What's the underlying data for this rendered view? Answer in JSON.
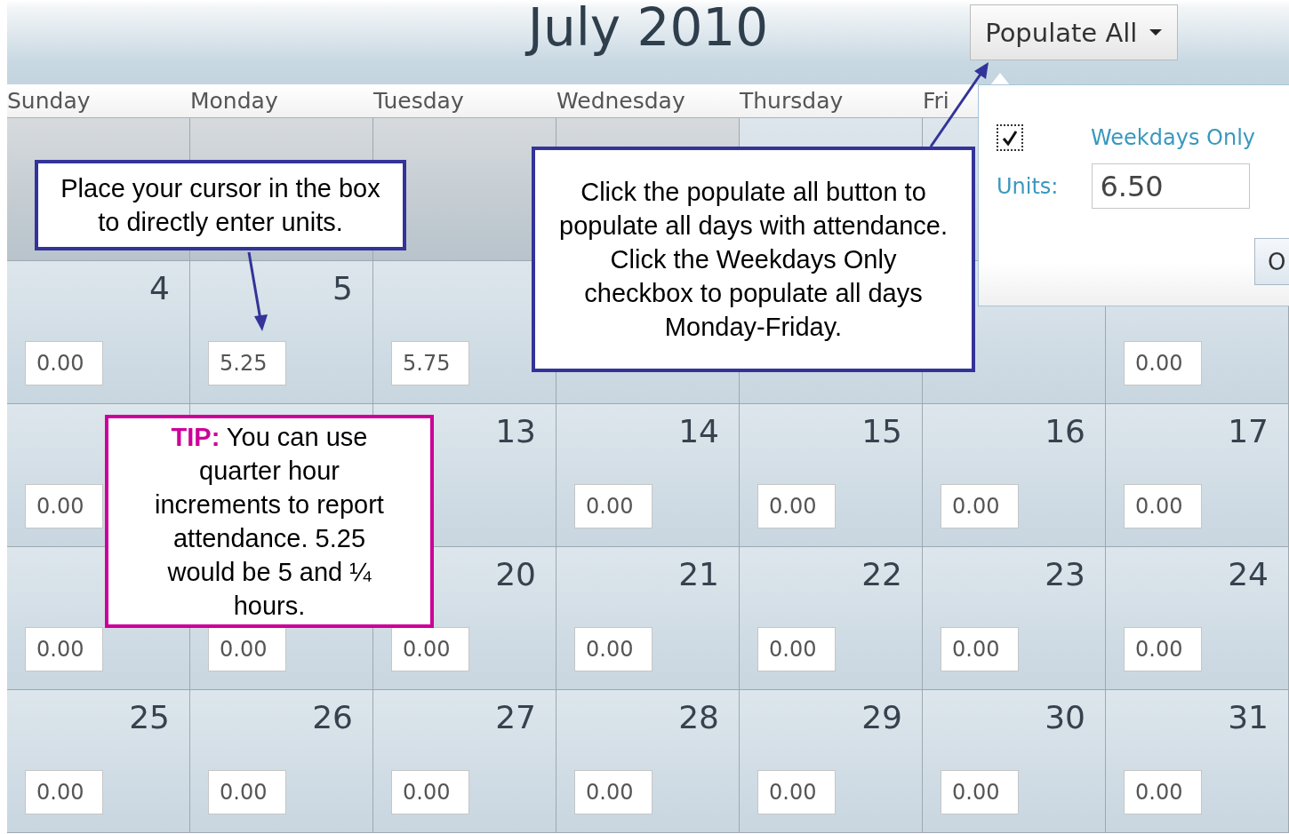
{
  "calendar": {
    "title": "July 2010",
    "populate_button": {
      "label": "Populate All"
    },
    "day_headers": [
      "Sunday",
      "Monday",
      "Tuesday",
      "Wednesday",
      "Thursday",
      "Fri"
    ],
    "weeks": [
      [
        {
          "in_month": false
        },
        {
          "in_month": false
        },
        {
          "in_month": false
        },
        {
          "in_month": false
        },
        {
          "in_month": true
        },
        {
          "in_month": true
        }
      ],
      [
        {
          "in_month": true,
          "day": "4",
          "value": "0.00"
        },
        {
          "in_month": true,
          "day": "5",
          "value": "5.25"
        },
        {
          "in_month": true,
          "value": "5.75"
        },
        {
          "in_month": true
        },
        {
          "in_month": true
        },
        {
          "in_month": true
        },
        {
          "in_month": true,
          "value": "0.00"
        }
      ],
      [
        {
          "in_month": true,
          "value": "0.00"
        },
        {
          "in_month": true
        },
        {
          "in_month": true,
          "day": "13"
        },
        {
          "in_month": true,
          "day": "14",
          "value": "0.00"
        },
        {
          "in_month": true,
          "day": "15",
          "value": "0.00"
        },
        {
          "in_month": true,
          "day": "16",
          "value": "0.00"
        },
        {
          "in_month": true,
          "day": "17",
          "value": "0.00"
        }
      ],
      [
        {
          "in_month": true,
          "value": "0.00"
        },
        {
          "in_month": true,
          "value": "0.00"
        },
        {
          "in_month": true,
          "day": "20",
          "value": "0.00"
        },
        {
          "in_month": true,
          "day": "21",
          "value": "0.00"
        },
        {
          "in_month": true,
          "day": "22",
          "value": "0.00"
        },
        {
          "in_month": true,
          "day": "23",
          "value": "0.00"
        },
        {
          "in_month": true,
          "day": "24",
          "value": "0.00"
        }
      ],
      [
        {
          "in_month": true,
          "day": "25",
          "value": "0.00"
        },
        {
          "in_month": true,
          "day": "26",
          "value": "0.00"
        },
        {
          "in_month": true,
          "day": "27",
          "value": "0.00"
        },
        {
          "in_month": true,
          "day": "28",
          "value": "0.00"
        },
        {
          "in_month": true,
          "day": "29",
          "value": "0.00"
        },
        {
          "in_month": true,
          "day": "30",
          "value": "0.00"
        },
        {
          "in_month": true,
          "day": "31",
          "value": "0.00"
        }
      ]
    ]
  },
  "populate_popup": {
    "weekdays_only": {
      "label": "Weekdays Only",
      "checked": true
    },
    "units_label": "Units:",
    "units_value": "6.50",
    "ok_button": "O"
  },
  "callouts": [
    {
      "kind": "note",
      "text": "Place your cursor in the box to directly enter units."
    },
    {
      "kind": "note",
      "text": "Click the populate all button to populate all days with attendance. Click the Weekdays Only checkbox to populate all days Monday-Friday."
    },
    {
      "kind": "tip",
      "text": "**TIP:** You can use quarter hour increments to report attendance. 5.25 would be 5 and ¼ hours."
    }
  ]
}
